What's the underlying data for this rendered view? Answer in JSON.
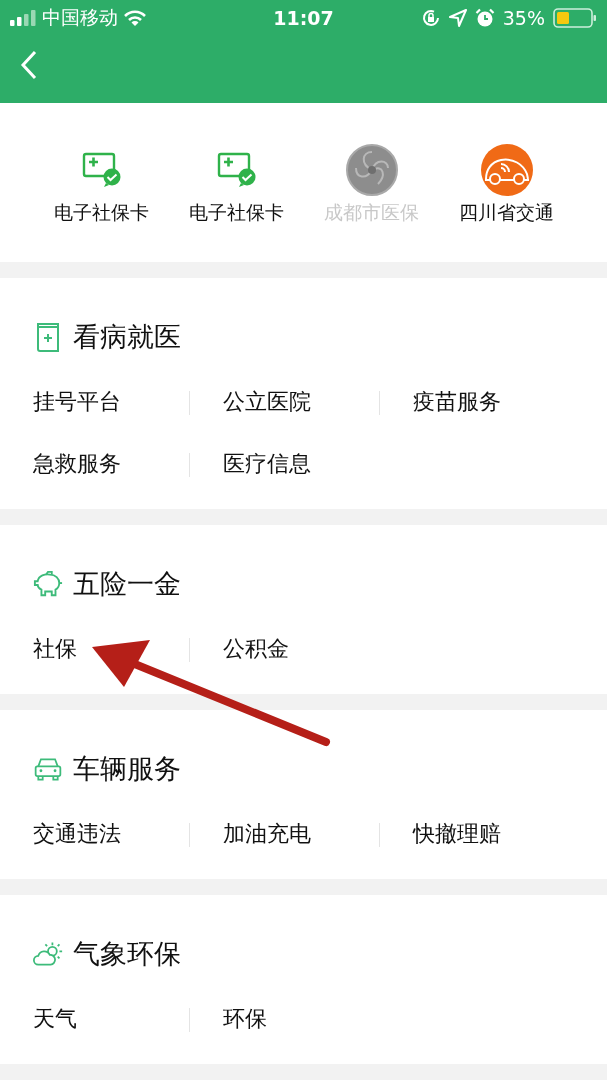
{
  "status_bar": {
    "carrier": "中国移动",
    "time": "11:07",
    "battery": "35%"
  },
  "common_services": {
    "items": [
      {
        "label": "电子社保卡",
        "kind": "card",
        "disabled": false
      },
      {
        "label": "电子社保卡",
        "kind": "card",
        "disabled": false
      },
      {
        "label": "成都市医保",
        "kind": "emblem",
        "disabled": true
      },
      {
        "label": "四川省交通",
        "kind": "car",
        "disabled": false
      }
    ]
  },
  "sections": [
    {
      "title": "看病就医",
      "kind": "medical",
      "items": [
        "挂号平台",
        "公立医院",
        "疫苗服务",
        "急救服务",
        "医疗信息"
      ]
    },
    {
      "title": "五险一金",
      "kind": "piggy",
      "items": [
        "社保",
        "公积金"
      ]
    },
    {
      "title": "车辆服务",
      "kind": "car",
      "items": [
        "交通违法",
        "加油充电",
        "快撤理赔"
      ]
    },
    {
      "title": "气象环保",
      "kind": "weather",
      "items": [
        "天气",
        "环保"
      ]
    }
  ]
}
